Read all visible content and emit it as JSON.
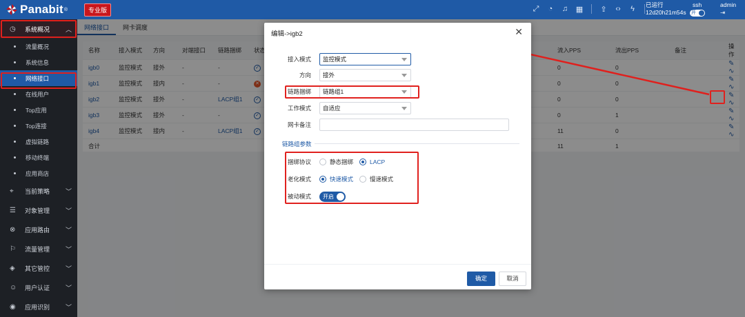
{
  "brand": {
    "name": "Panabit",
    "mark": "®",
    "edition": "专业版"
  },
  "topbar": {
    "icons": [
      "expand-icon",
      "dashboard-icon",
      "bell-icon",
      "grid-icon",
      "upload-icon",
      "code-icon",
      "flash-icon"
    ],
    "runtime_label": "已运行",
    "runtime_value": "12d20h21m54s",
    "toggle_label": "开",
    "ssh_label": "ssh",
    "user": "admin"
  },
  "sidebar": {
    "groups": [
      {
        "label": "系统概况",
        "icon": "dashboard-icon",
        "open": true
      },
      {
        "label": "当前策略",
        "icon": "location-icon"
      },
      {
        "label": "对象管理",
        "icon": "database-icon"
      },
      {
        "label": "应用路由",
        "icon": "route-icon"
      },
      {
        "label": "流量管理",
        "icon": "flag-icon"
      },
      {
        "label": "其它管控",
        "icon": "cube-icon"
      },
      {
        "label": "用户认证",
        "icon": "user-icon"
      },
      {
        "label": "应用识别",
        "icon": "eye-icon"
      }
    ],
    "sub_items": [
      "流量概况",
      "系统信息",
      "网络接口",
      "在线用户",
      "Top应用",
      "Top连接",
      "虚拟链路",
      "移动终端",
      "应用商店"
    ]
  },
  "tabs": [
    "网络接口",
    "网卡调度"
  ],
  "table": {
    "headers": [
      "名称",
      "接入模式",
      "方向",
      "对端接口",
      "链路捆绑",
      "状态"
    ],
    "right_headers": [
      "流入PPS",
      "流出PPS",
      "备注",
      "操作"
    ],
    "rows": [
      {
        "name": "igb0",
        "mode": "监控模式",
        "dir": "接外",
        "peer": "-",
        "bond": "-",
        "status": "ok",
        "pps_in": "0",
        "pps_out": "0"
      },
      {
        "name": "igb1",
        "mode": "监控模式",
        "dir": "接内",
        "peer": "-",
        "bond": "-",
        "status": "bad",
        "pps_in": "0",
        "pps_out": "0"
      },
      {
        "name": "igb2",
        "mode": "监控模式",
        "dir": "接外",
        "peer": "-",
        "bond": "LACP组1",
        "status": "ok",
        "pps_in": "0",
        "pps_out": "0"
      },
      {
        "name": "igb3",
        "mode": "监控模式",
        "dir": "接外",
        "peer": "-",
        "bond": "-",
        "status": "ok",
        "pps_in": "0",
        "pps_out": "1"
      },
      {
        "name": "igb4",
        "mode": "监控模式",
        "dir": "接内",
        "peer": "-",
        "bond": "LACP组1",
        "status": "ok",
        "pps_in": "11",
        "pps_out": "0"
      }
    ],
    "total_label": "合计",
    "total_in": "11",
    "total_out": "1"
  },
  "dialog": {
    "title": "编辑->igb2",
    "fields": [
      {
        "label": "接入模式",
        "value": "监控模式"
      },
      {
        "label": "方向",
        "value": "接外"
      },
      {
        "label": "链路捆绑",
        "value": "链路组1"
      },
      {
        "label": "工作模式",
        "value": "自适应"
      },
      {
        "label": "网卡备注",
        "value": ""
      }
    ],
    "section_label": "链路组参数",
    "protocol_label": "捆绑协议",
    "protocol_options": [
      "静态捆绑",
      "LACP"
    ],
    "aging_label": "老化模式",
    "aging_options": [
      "快速模式",
      "慢速模式"
    ],
    "passive_label": "被动模式",
    "passive_value": "开启",
    "ok_label": "确定",
    "cancel_label": "取消"
  }
}
